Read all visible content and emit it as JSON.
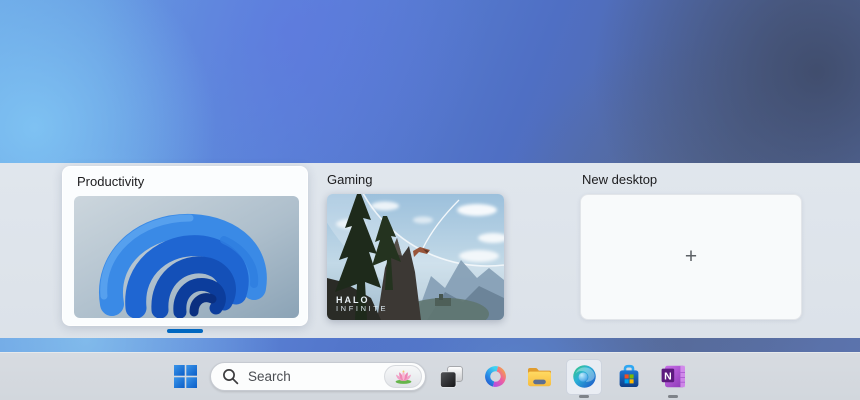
{
  "task_view": {
    "desktops": [
      {
        "label": "Productivity",
        "state": "active",
        "thumbnail": "windows-bloom-wallpaper"
      },
      {
        "label": "Gaming",
        "state": "inactive",
        "thumbnail": "halo-infinite-screenshot",
        "caption": {
          "line1": "HALO",
          "line2": "INFINITE"
        }
      }
    ],
    "new_desktop_label": "New desktop",
    "new_desktop_plus": "+"
  },
  "taskbar": {
    "search_placeholder": "Search",
    "search_highlight_icon": "lotus-flower",
    "onenote_letter": "N",
    "icons": [
      {
        "name": "start",
        "state": "normal"
      },
      {
        "name": "task-view",
        "state": "normal"
      },
      {
        "name": "copilot",
        "state": "normal"
      },
      {
        "name": "file-explorer",
        "state": "normal"
      },
      {
        "name": "edge",
        "state": "active-running"
      },
      {
        "name": "microsoft-store",
        "state": "normal"
      },
      {
        "name": "onenote",
        "state": "running"
      }
    ]
  },
  "colors": {
    "accent": "#0067c0",
    "panel_bg": "#dde3ea",
    "taskbar_bg": "#d4d9df",
    "card_bg": "#fbfdfe"
  }
}
